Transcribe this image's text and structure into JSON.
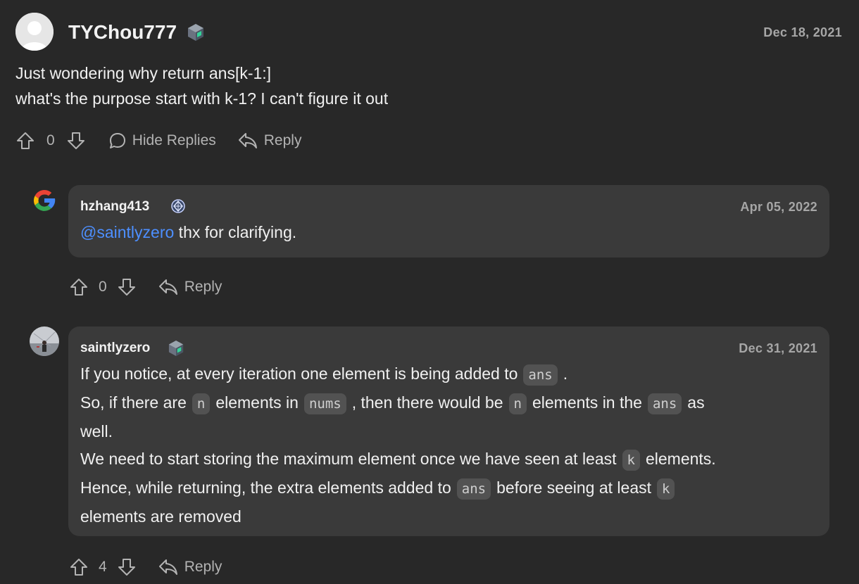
{
  "top": {
    "username": "TYChou777",
    "date": "Dec 18, 2021",
    "lines": [
      "Just wondering why return ans[k-1:]",
      "what's the purpose start with k-1? I can't figure it out"
    ],
    "votes": "0",
    "hide_replies": "Hide Replies",
    "reply": "Reply"
  },
  "reply1": {
    "username": "hzhang413",
    "date": "Apr 05, 2022",
    "mention": "@saintlyzero",
    "text": " thx for clarifying.",
    "votes": "0",
    "reply": "Reply"
  },
  "reply2": {
    "username": "saintlyzero",
    "date": "Dec 31, 2021",
    "l1a": "If you notice, at every iteration one element is being added to",
    "c_ans1": "ans",
    "l1b": ".",
    "l2a": "So, if there are",
    "c_n1": "n",
    "l2b": "elements in",
    "c_nums": "nums",
    "l2c": ", then there would be",
    "c_n2": "n",
    "l2d": "elements in the",
    "c_ans2": "ans",
    "l2e": "as",
    "l3": "well.",
    "l4a": "We need to start storing the maximum element once we have seen at least",
    "c_k1": "k",
    "l4b": "elements.",
    "l5a": "Hence, while returning, the extra elements added to",
    "c_ans3": "ans",
    "l5b": "before seeing at least",
    "c_k2": "k",
    "l6": "elements are removed",
    "votes": "4",
    "reply": "Reply"
  },
  "colors": {
    "background": "#282828",
    "card": "#3a3a3a",
    "mention": "#4d8fff",
    "muted": "#a6a6a6"
  }
}
